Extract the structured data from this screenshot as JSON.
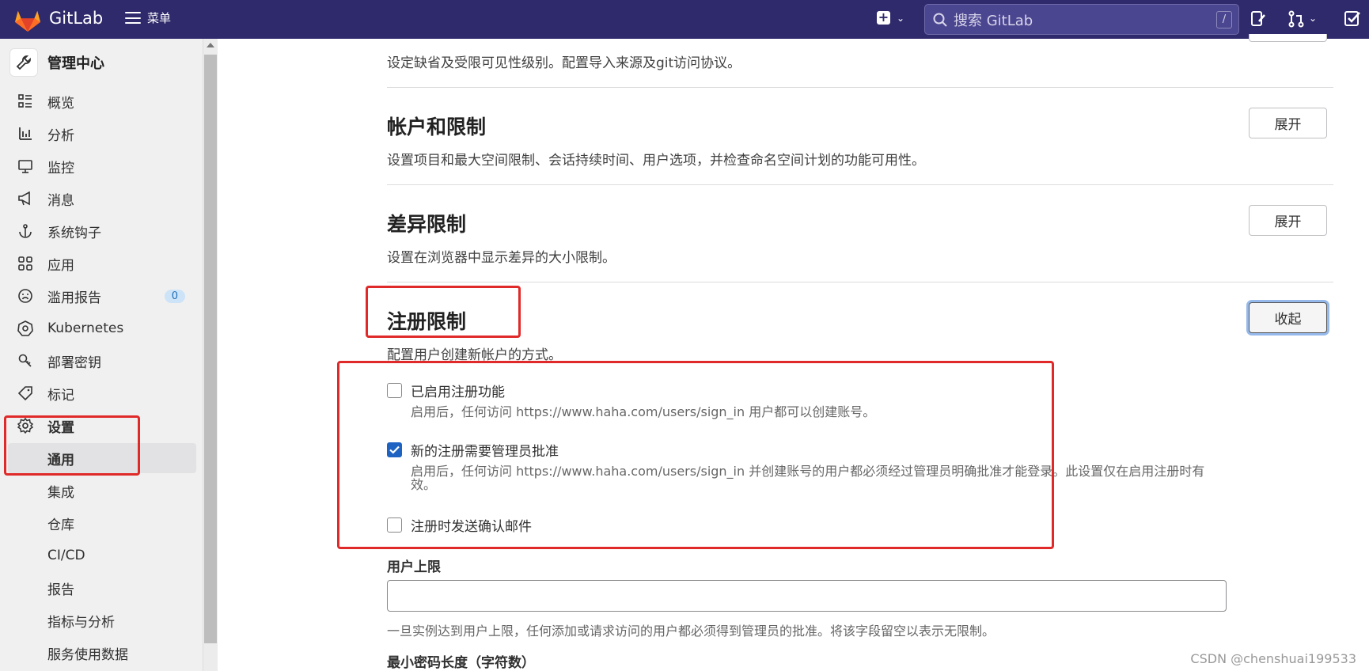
{
  "topbar": {
    "brand": "GitLab",
    "menu_label": "菜单",
    "search_placeholder": "搜索 GitLab",
    "search_shortcut": "/"
  },
  "sidebar": {
    "header_title": "管理中心",
    "items": [
      {
        "label": "概览",
        "icon": "overview-icon"
      },
      {
        "label": "分析",
        "icon": "analytics-icon"
      },
      {
        "label": "监控",
        "icon": "monitor-icon"
      },
      {
        "label": "消息",
        "icon": "messages-icon"
      },
      {
        "label": "系统钩子",
        "icon": "hook-icon"
      },
      {
        "label": "应用",
        "icon": "applications-icon"
      },
      {
        "label": "滥用报告",
        "icon": "abuse-icon",
        "badge": "0"
      },
      {
        "label": "Kubernetes",
        "icon": "kubernetes-icon"
      },
      {
        "label": "部署密钥",
        "icon": "key-icon"
      },
      {
        "label": "标记",
        "icon": "label-icon"
      },
      {
        "label": "设置",
        "icon": "gear-icon"
      }
    ],
    "sub_items": [
      {
        "label": "通用",
        "active": true
      },
      {
        "label": "集成"
      },
      {
        "label": "仓库"
      },
      {
        "label": "CI/CD"
      },
      {
        "label": "报告"
      },
      {
        "label": "指标与分析"
      },
      {
        "label": "服务使用数据"
      }
    ]
  },
  "main": {
    "visibility_desc": "设定缺省及受限可见性级别。配置导入来源及git访问协议。",
    "account": {
      "title": "帐户和限制",
      "desc": "设置项目和最大空间限制、会话持续时间、用户选项，并检查命名空间计划的功能可用性。",
      "button": "展开"
    },
    "diff": {
      "title": "差异限制",
      "desc": "设置在浏览器中显示差异的大小限制。",
      "button": "展开"
    },
    "signup": {
      "title": "注册限制",
      "desc": "配置用户创建新帐户的方式。",
      "button": "收起",
      "options": [
        {
          "label": "已启用注册功能",
          "help": "启用后，任何访问 https://www.haha.com/users/sign_in 用户都可以创建账号。",
          "checked": false
        },
        {
          "label": "新的注册需要管理员批准",
          "help": "启用后，任何访问 https://www.haha.com/users/sign_in 并创建账号的用户都必须经过管理员明确批准才能登录。此设置仅在启用注册时有效。",
          "checked": true
        },
        {
          "label": "注册时发送确认邮件",
          "help": "",
          "checked": false
        }
      ],
      "user_cap_label": "用户上限",
      "user_cap_value": "",
      "user_cap_help": "一旦实例达到用户上限，任何添加或请求访问的用户都必须得到管理员的批准。将该字段留空以表示无限制。",
      "min_password_label": "最小密码长度（字符数）"
    }
  },
  "watermark": "CSDN @chenshuai199533"
}
